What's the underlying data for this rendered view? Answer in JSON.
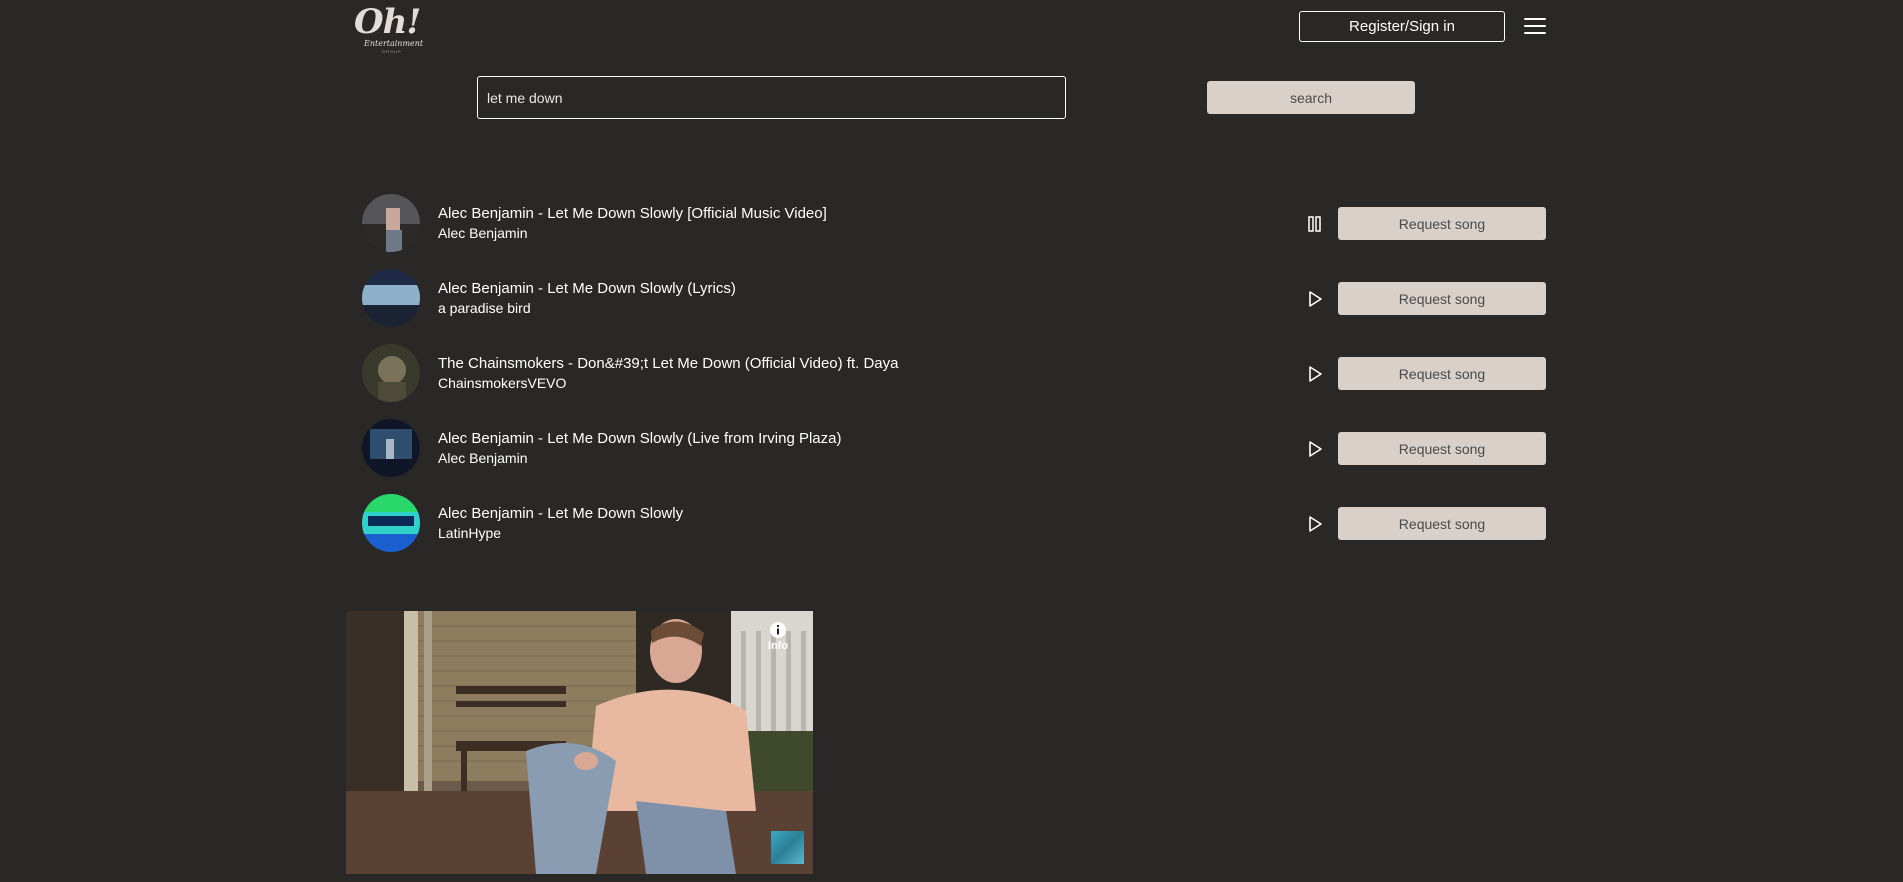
{
  "header": {
    "logo_main": "Oh!",
    "logo_sub": "Entertainment",
    "logo_sub2": "GROUP",
    "register_label": "Register/Sign in"
  },
  "search": {
    "value": "let me down",
    "button_label": "search"
  },
  "results": [
    {
      "title": "Alec Benjamin - Let Me Down Slowly [Official Music Video]",
      "channel": "Alec Benjamin",
      "state": "playing",
      "button": "Request song",
      "colors": [
        "#6a6a6e",
        "#2c2a28"
      ]
    },
    {
      "title": "Alec Benjamin - Let Me Down Slowly (Lyrics)",
      "channel": "a paradise bird",
      "state": "paused",
      "button": "Request song",
      "colors": [
        "#a8c2d8",
        "#2b3a55"
      ]
    },
    {
      "title": "The Chainsmokers - Don&#39;t Let Me Down (Official Video) ft. Daya",
      "channel": "ChainsmokersVEVO",
      "state": "paused",
      "button": "Request song",
      "colors": [
        "#6b6a52",
        "#3a3a2c"
      ]
    },
    {
      "title": "Alec Benjamin - Let Me Down Slowly (Live from Irving Plaza)",
      "channel": "Alec Benjamin",
      "state": "paused",
      "button": "Request song",
      "colors": [
        "#3d5c7a",
        "#121c30"
      ]
    },
    {
      "title": "Alec Benjamin - Let Me Down Slowly",
      "channel": "LatinHype",
      "state": "paused",
      "button": "Request song",
      "colors": [
        "#2fd1c9",
        "#1a5fd0"
      ]
    }
  ],
  "video": {
    "info_label": "Info"
  }
}
